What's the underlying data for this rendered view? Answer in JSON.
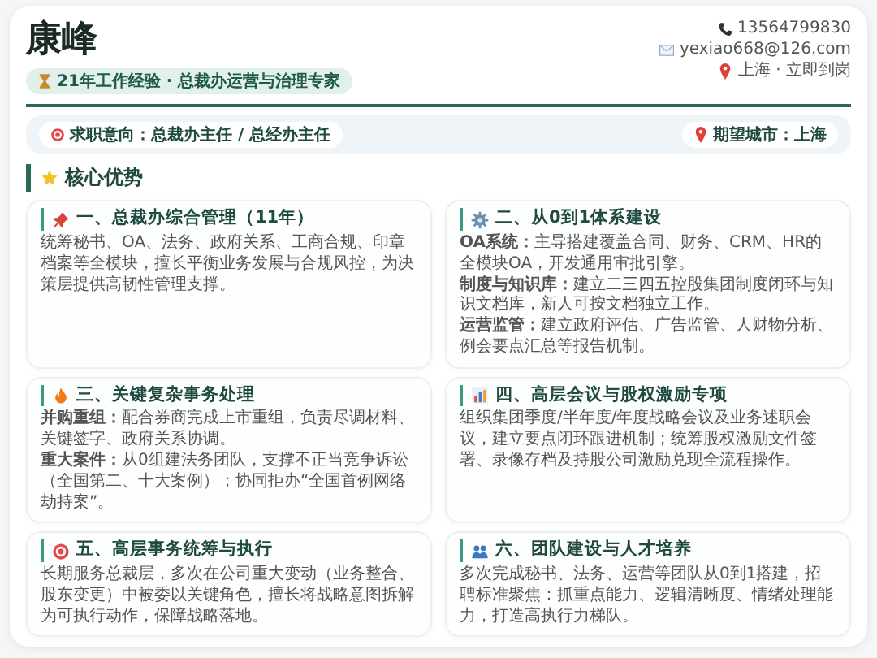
{
  "header": {
    "name": "康峰",
    "tag": "21年工作经验 · 总裁办运营与治理专家",
    "contacts": [
      {
        "kind": "phone",
        "text": "13564799830"
      },
      {
        "kind": "email",
        "text": "yexiao668@126.com"
      },
      {
        "kind": "location",
        "text": "上海 · 立即到岗"
      }
    ]
  },
  "intention": {
    "position": "求职意向：总裁办主任 / 总经办主任",
    "city": "期望城市：上海"
  },
  "section": {
    "title": "核心优势"
  },
  "cards": [
    {
      "title": "一、总裁办综合管理（11年）",
      "paragraphs": [
        "统筹秘书、OA、法务、政府关系、工商合规、印章档案等全模块，擅长平衡业务发展与合规风控，为决策层提供高韧性管理支撑。"
      ]
    },
    {
      "title": "二、从0到1体系建设",
      "paragraphs": [
        "**OA系统：**主导搭建覆盖合同、财务、CRM、HR的全模块OA，开发通用审批引擎。",
        "**制度与知识库：**建立二三四五控股集团制度闭环与知识文档库，新人可按文档独立工作。",
        "**运营监管：**建立政府评估、广告监管、人财物分析、例会要点汇总等报告机制。"
      ]
    },
    {
      "title": "三、关键复杂事务处理",
      "paragraphs": [
        "**并购重组：**配合券商完成上市重组，负责尽调材料、关键签字、政府关系协调。",
        "**重大案件：**从0组建法务团队，支撑不正当竞争诉讼（全国第二、十大案例）；协同拒办“全国首例网络劫持案”。"
      ]
    },
    {
      "title": "四、高层会议与股权激励专项",
      "paragraphs": [
        "组织集团季度/半年度/年度战略会议及业务述职会议，建立要点闭环跟进机制；统筹股权激励文件签署、录像存档及持股公司激励兑现全流程操作。"
      ]
    },
    {
      "title": "五、高层事务统筹与执行",
      "paragraphs": [
        "长期服务总裁层，多次在公司重大变动（业务整合、股东变更）中被委以关键角色，擅长将战略意图拆解为可执行动作，保障战略落地。"
      ]
    },
    {
      "title": "六、团队建设与人才培养",
      "paragraphs": [
        "多次完成秘书、法务、运营等团队从0到1搭建，招聘标准聚焦：抓重点能力、逻辑清晰度、情绪处理能力，打造高执行力梯队。"
      ]
    }
  ]
}
